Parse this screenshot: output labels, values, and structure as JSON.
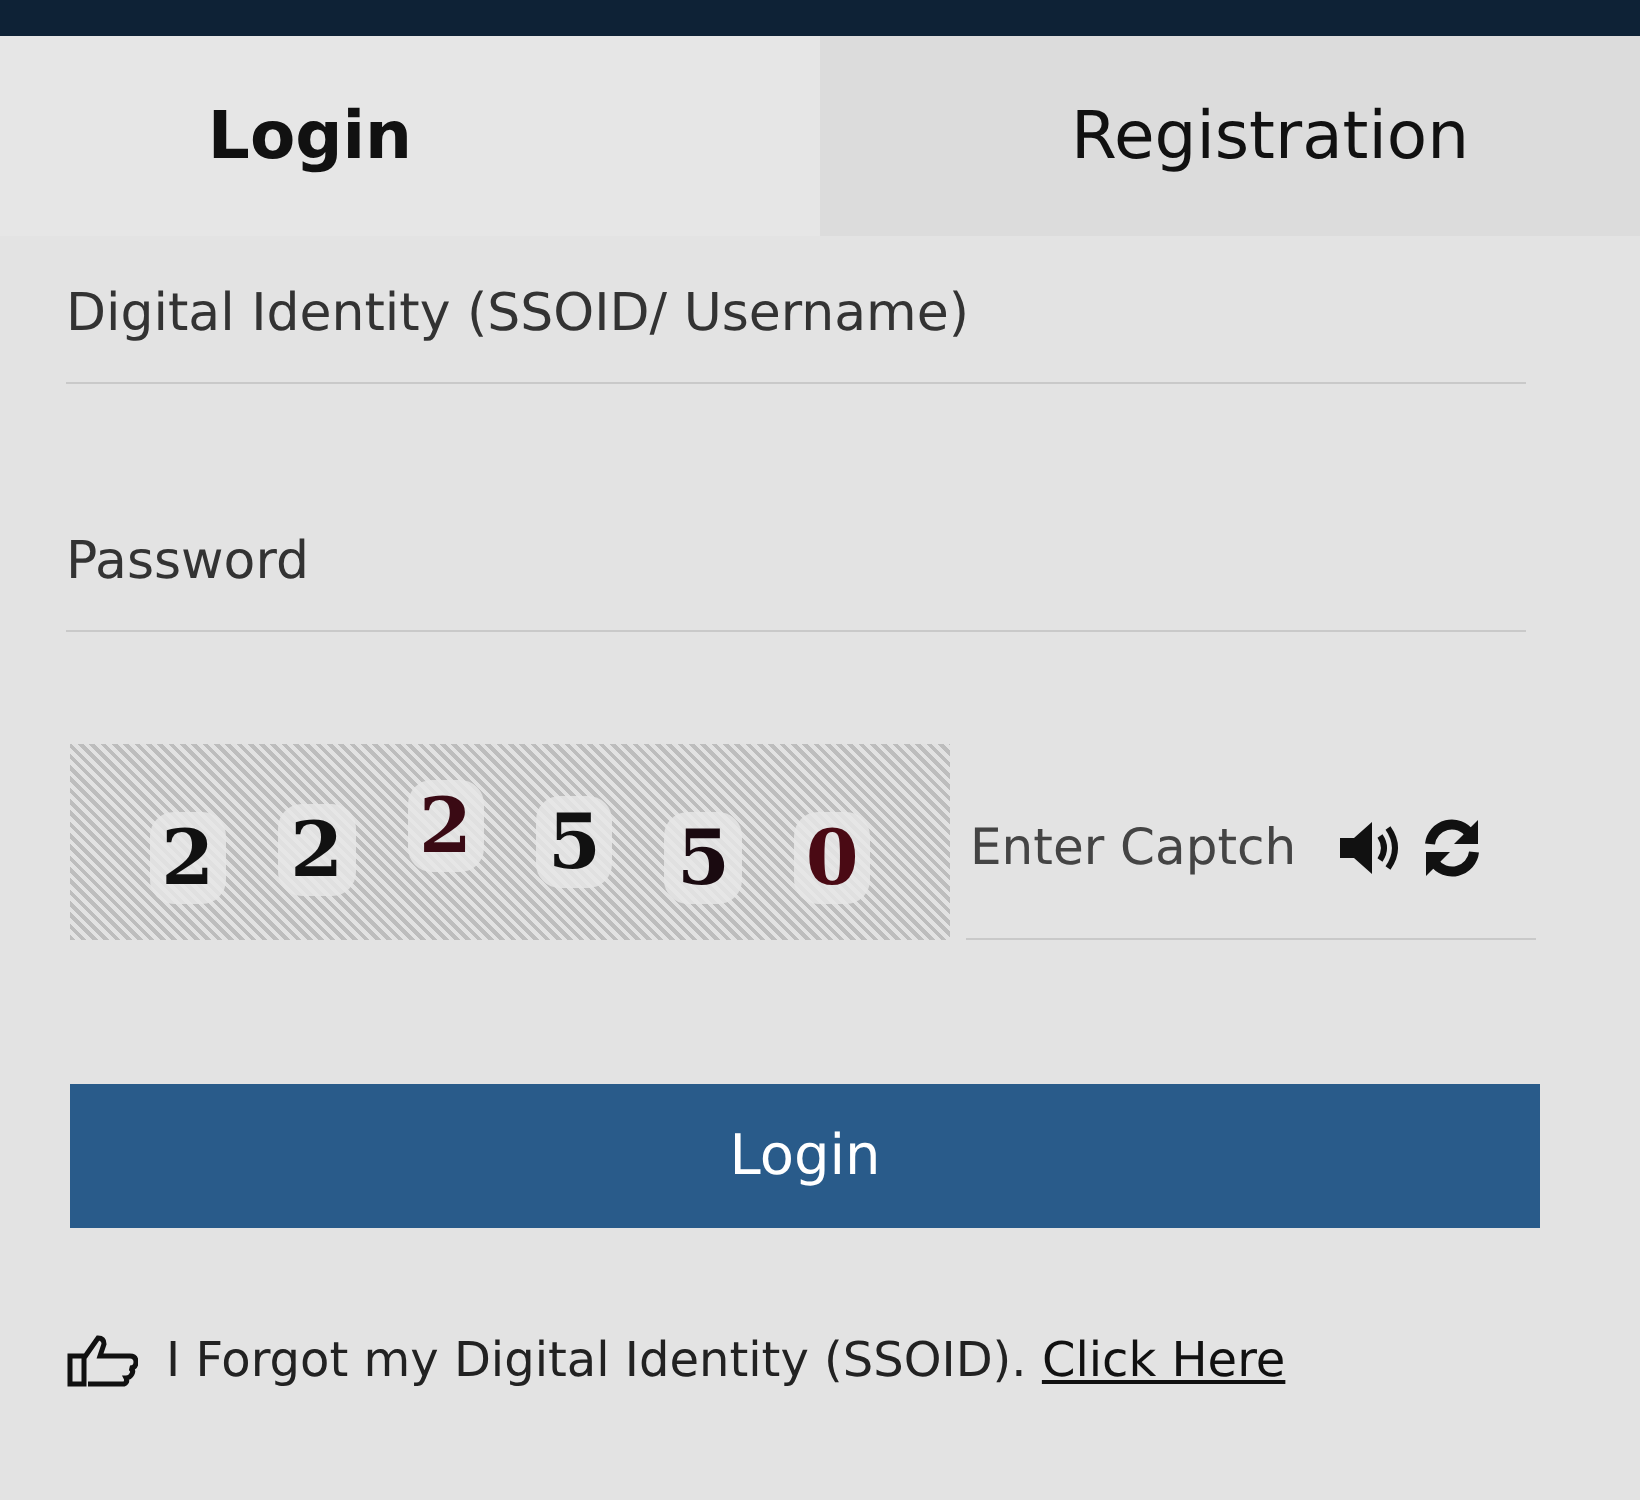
{
  "tabs": [
    {
      "label": "Login",
      "selected": true
    },
    {
      "label": "Registration",
      "selected": false
    }
  ],
  "fields": [
    {
      "placeholder": "Digital Identity (SSOID/ Username)"
    },
    {
      "placeholder": "Password"
    }
  ],
  "captcha": {
    "digits": [
      "2",
      "2",
      "2",
      "5",
      "5",
      "0"
    ],
    "placeholder": "Enter Captch"
  },
  "login_button": "Login",
  "forgot": {
    "text": "I Forgot my Digital Identity (SSOID).",
    "link": "Click Here"
  }
}
